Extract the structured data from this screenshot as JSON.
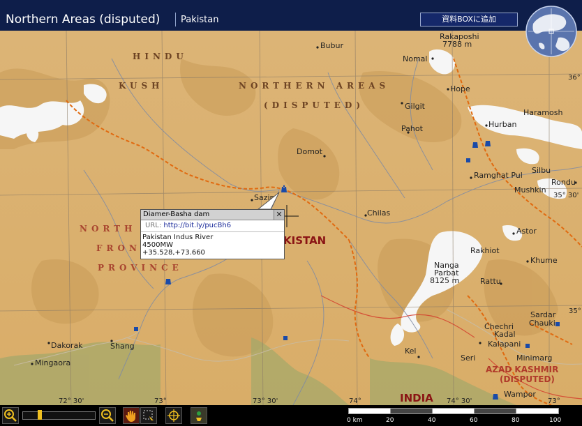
{
  "title_bar": {
    "title": "Northern Areas (disputed)",
    "subtitle": "Pakistan",
    "add_button": "資料BOXに追加"
  },
  "map": {
    "regions": {
      "hindu": "HINDU",
      "kush": "KUSH",
      "northern_areas": "NORTHERN AREAS",
      "disputed": "(DISPUTED)",
      "north": "NORTH",
      "front": "FRON",
      "province": "PROVINCE"
    },
    "country_pakistan": "KISTAN",
    "country_india": "INDIA",
    "azad_kashmir": "AZAD KASHMIR",
    "azad_disputed": "(DISPUTED)",
    "places": {
      "bubur": "Bubur",
      "nomal": "Nomal",
      "rakaposhi": "Rakaposhi",
      "rakaposhi_h": "7788 m",
      "hope": "Hope",
      "gilgit": "Gilgit",
      "haramosh": "Haramosh",
      "pahot": "Pahot",
      "hurban": "Hurban",
      "domot": "Domot",
      "ramghat": "Ramghat Pul",
      "silbu": "Silbu",
      "rondu": "Rondu",
      "mushkin": "Mushkin",
      "sazin": "Sazin",
      "chilas": "Chilas",
      "astor": "Astor",
      "rakhiot": "Rakhiot",
      "khume": "Khume",
      "nanga1": "Nanga",
      "nanga2": "Parbat",
      "nanga_h": "8125 m",
      "rattu": "Rattu",
      "sardar": "Sardar",
      "chauki": "Chauki",
      "chechri": "Chechri",
      "kadal": "Kadal",
      "kalapani": "Kalapani",
      "dakorak": "Dakorak",
      "shang": "Shang",
      "mingaora": "Mingaora",
      "kel": "Kel",
      "seri": "Seri",
      "minimarg": "Minimarg",
      "wampor": "Wampor"
    },
    "coords": {
      "c36": "36°",
      "c3530": "35° 30'",
      "c35": "35°",
      "lon7230": "72° 30'",
      "lon73a": "73°",
      "lon7330": "73° 30'",
      "lon74": "74°",
      "lon7430": "74° 30'",
      "lon73b": "73°"
    }
  },
  "popup": {
    "title": "Diamer-Basha dam",
    "close": "✕",
    "url_label": "URL:",
    "url": "http://bit.ly/pucBh6",
    "line1": "Pakistan Indus River",
    "line2": "4500MW",
    "line3": "+35.528,+73.660"
  },
  "toolbar": {
    "zoom_in_icon": "zoom-in-icon",
    "zoom_out_icon": "zoom-out-icon",
    "hand_icon": "hand-icon",
    "select_icon": "selection-icon",
    "target_icon": "crosshair-icon",
    "info_icon": "info-icon"
  },
  "scale": {
    "labels": [
      "0 km",
      "20",
      "40",
      "60",
      "80",
      "100"
    ]
  },
  "colors": {
    "title_bg": "#0e1e4a",
    "land": "#dcb272",
    "snow": "#f4f4f4",
    "border": "#e06a10",
    "pin": "#1a4aa8"
  }
}
